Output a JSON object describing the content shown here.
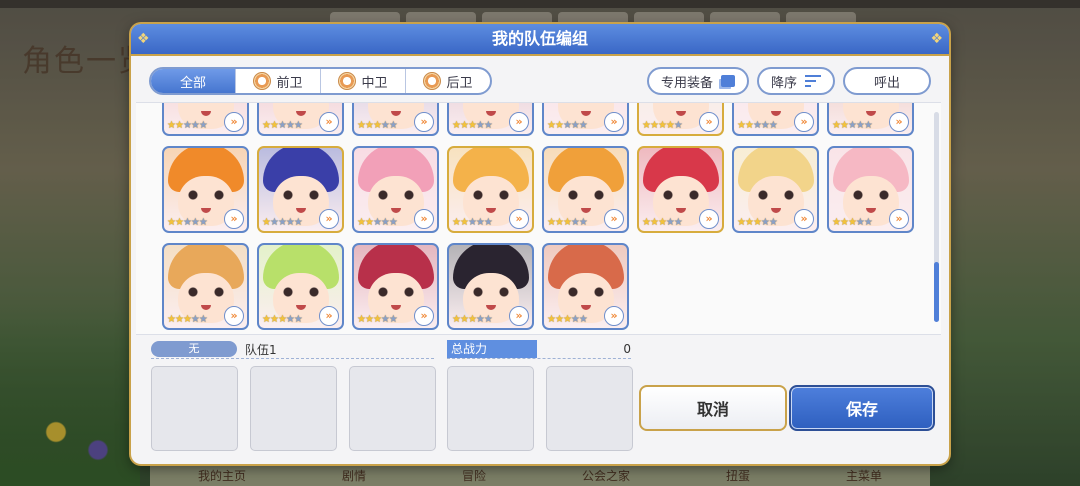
{
  "background": {
    "title": "角色一览",
    "bottom_items": [
      "我的主页",
      "剧情",
      "冒险",
      "公会之家",
      "扭蛋",
      "主菜单"
    ]
  },
  "dialog": {
    "title": "我的队伍编组",
    "filters": [
      {
        "label": "全部",
        "active": true
      },
      {
        "label": "前卫",
        "active": false
      },
      {
        "label": "中卫",
        "active": false
      },
      {
        "label": "后卫",
        "active": false
      }
    ],
    "right_buttons": {
      "equipment": "专用装备",
      "sort": "降序",
      "call": "呼出"
    },
    "team": {
      "badge": "无",
      "name": "队伍1"
    },
    "power": {
      "label": "总战力",
      "value": "0"
    },
    "actions": {
      "cancel": "取消",
      "save": "保存"
    }
  },
  "characters": [
    {
      "stars": 2,
      "hair": "#e36b6b",
      "frame": "blue"
    },
    {
      "stars": 2,
      "hair": "#c94a5a",
      "frame": "blue"
    },
    {
      "stars": 3,
      "hair": "#6a4fa0",
      "frame": "blue"
    },
    {
      "stars": 3,
      "hair": "#a45070",
      "frame": "blue"
    },
    {
      "stars": 2,
      "hair": "#f2a3b5",
      "frame": "blue"
    },
    {
      "stars": 4,
      "hair": "#e9d7a8",
      "frame": "gold"
    },
    {
      "stars": 2,
      "hair": "#f0b8c8",
      "frame": "blue"
    },
    {
      "stars": 2,
      "hair": "#c85a3a",
      "frame": "blue"
    },
    {
      "stars": 2,
      "hair": "#f08a2a",
      "frame": "blue"
    },
    {
      "stars": 1,
      "hair": "#3a3fa8",
      "frame": "gold"
    },
    {
      "stars": 2,
      "hair": "#f2a0b8",
      "frame": "blue"
    },
    {
      "stars": 2,
      "hair": "#f4b24a",
      "frame": "gold"
    },
    {
      "stars": 3,
      "hair": "#f0a03a",
      "frame": "blue"
    },
    {
      "stars": 3,
      "hair": "#d8384a",
      "frame": "gold"
    },
    {
      "stars": 3,
      "hair": "#f2d48a",
      "frame": "blue"
    },
    {
      "stars": 3,
      "hair": "#f6b8c4",
      "frame": "blue"
    },
    {
      "stars": 3,
      "hair": "#e8a85a",
      "frame": "blue"
    },
    {
      "stars": 3,
      "hair": "#b8e06a",
      "frame": "blue"
    },
    {
      "stars": 3,
      "hair": "#b8304a",
      "frame": "blue"
    },
    {
      "stars": 3,
      "hair": "#2a2430",
      "frame": "blue"
    },
    {
      "stars": 3,
      "hair": "#d86a4a",
      "frame": "blue"
    }
  ]
}
